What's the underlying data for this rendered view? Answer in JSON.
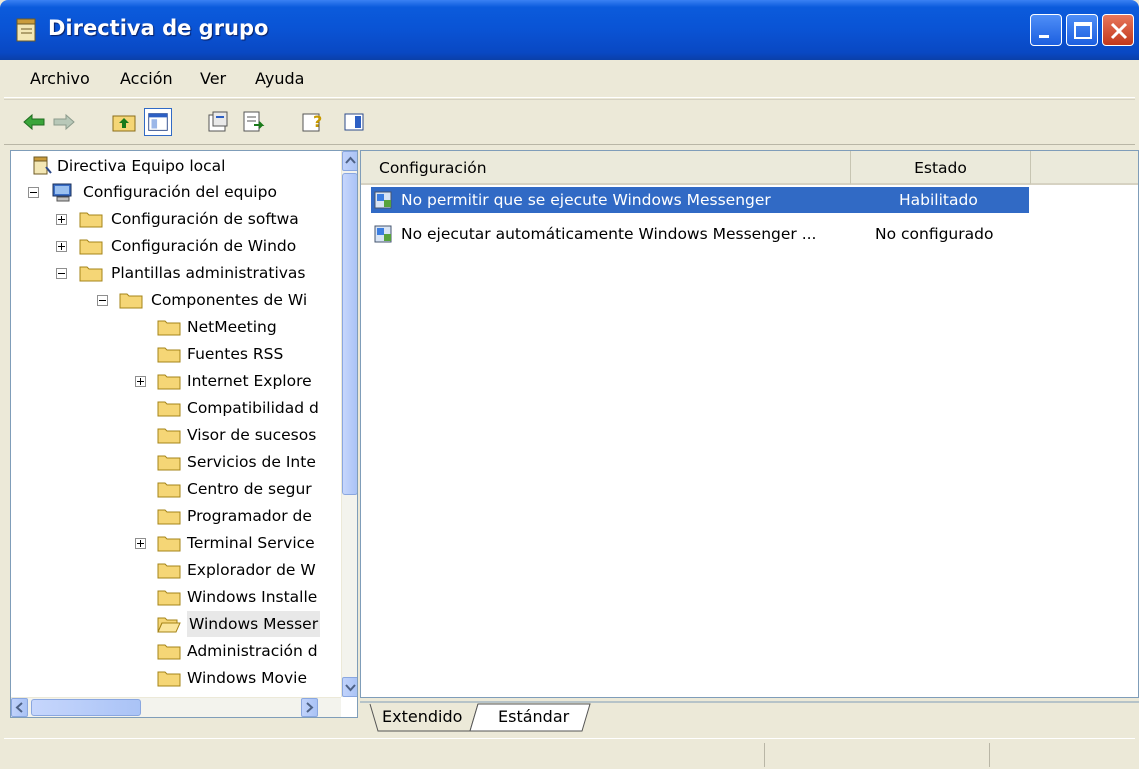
{
  "window": {
    "title": "Directiva de grupo"
  },
  "menu": [
    "Archivo",
    "Acción",
    "Ver",
    "Ayuda"
  ],
  "toolbar_icons": [
    "back-icon",
    "forward-icon",
    "up-folder-icon",
    "show-tree-icon",
    "properties-icon",
    "export-list-icon",
    "help-icon",
    "show-action-pane-icon"
  ],
  "tree": [
    {
      "label": "Directiva Equipo local",
      "icon": "policy-icon"
    },
    {
      "label": "Configuración del equipo",
      "icon": "computer-icon"
    },
    {
      "label": "Configuración de softwa"
    },
    {
      "label": "Configuración de Windo"
    },
    {
      "label": "Plantillas administrativas"
    },
    {
      "label": "Componentes de Wi"
    },
    {
      "label": "NetMeeting"
    },
    {
      "label": "Fuentes RSS"
    },
    {
      "label": "Internet Explore"
    },
    {
      "label": "Compatibilidad d"
    },
    {
      "label": "Visor de sucesos"
    },
    {
      "label": "Servicios de Inte"
    },
    {
      "label": "Centro de segur"
    },
    {
      "label": "Programador de"
    },
    {
      "label": "Terminal Service"
    },
    {
      "label": "Explorador de W"
    },
    {
      "label": "Windows Installe"
    },
    {
      "label": "Windows Messer"
    },
    {
      "label": "Administración d"
    },
    {
      "label": "Windows Movie"
    }
  ],
  "list": {
    "columns": [
      "Configuración",
      "Estado"
    ],
    "rows": [
      {
        "setting": "No permitir que se ejecute Windows Messenger",
        "state": "Habilitado",
        "selected": true
      },
      {
        "setting": "No ejecutar automáticamente Windows Messenger ...",
        "state": "No configurado",
        "selected": false
      }
    ]
  },
  "tabs": [
    "Extendido",
    "Estándar"
  ],
  "active_tab": "Estándar",
  "colors": {
    "titlebar": "#0a53d4",
    "selection": "#316ac5",
    "folder": "#f5d676"
  }
}
